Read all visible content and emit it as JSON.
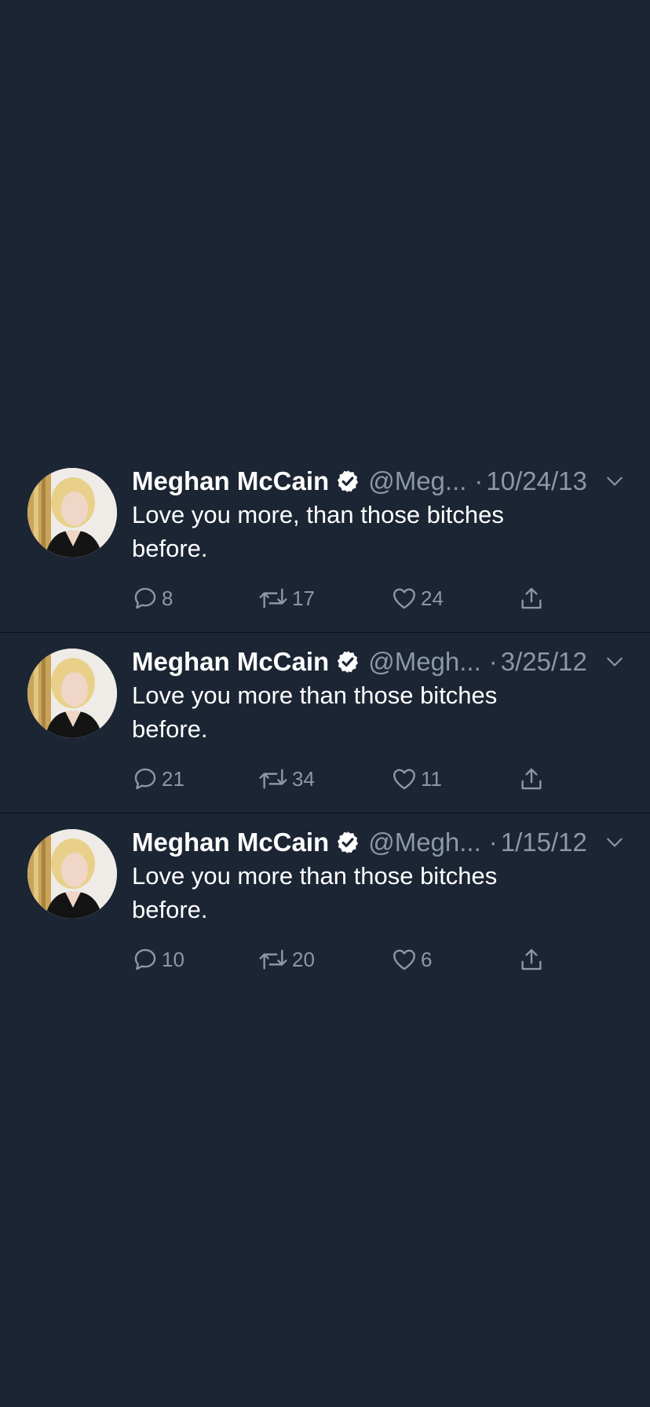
{
  "tweets": [
    {
      "name": "Meghan McCain",
      "handle": "@Meg...",
      "dot": "·",
      "date": "10/24/13",
      "text_line1": "Love you more, than those bitches",
      "text_line2": "before.",
      "replies": "8",
      "retweets": "17",
      "likes": "24"
    },
    {
      "name": "Meghan McCain",
      "handle": "@Megh...",
      "dot": "·",
      "date": "3/25/12",
      "text_line1": "Love you more than those bitches",
      "text_line2": "before.",
      "replies": "21",
      "retweets": "34",
      "likes": "11"
    },
    {
      "name": "Meghan McCain",
      "handle": "@Megh...",
      "dot": "·",
      "date": "1/15/12",
      "text_line1": "Love you more than those bitches",
      "text_line2": "before.",
      "replies": "10",
      "retweets": "20",
      "likes": "6"
    }
  ],
  "icons": {
    "verified": "verified-badge-icon",
    "caret": "chevron-down-icon",
    "reply": "reply-icon",
    "retweet": "retweet-icon",
    "like": "heart-icon",
    "share": "share-icon"
  },
  "colors": {
    "background": "#1c2533",
    "secondary_text": "#8b98a5",
    "divider": "#0d121a"
  }
}
